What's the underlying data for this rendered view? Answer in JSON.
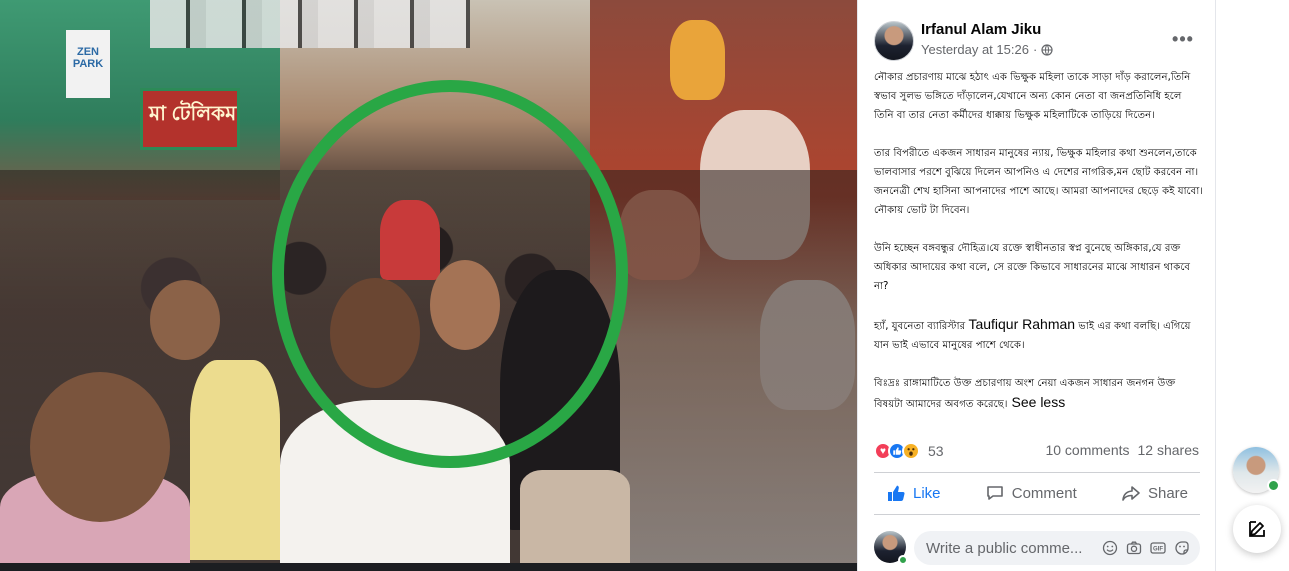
{
  "post": {
    "author": "Irfanul Alam Jiku",
    "timestamp": "Yesterday at 15:26",
    "privacy_separator": "·",
    "privacy_icon": "globe-icon",
    "more_icon": "more-options-icon",
    "paragraphs": [
      "নৌকার প্রচারণায় মাঝে হঠাৎ এক ভিক্ষুক মহিলা তাকে সাড়া দাঁড় করালেন,তিনি স্বভাব সুলভ ভঙ্গিতে দাঁড়ালেন,যেখানে অন্য কোন নেতা বা জনপ্রতিনিধি হলে তিনি বা তার নেতা কর্মীদের ধাক্কায় ভিক্ষুক মহিলাটিকে তাড়িয়ে দিতেন।",
      "তার বিপরীতে একজন সাধারন মানুষের ন্যায়, ভিক্ষুক মহিলার কথা শুনলেন,তাকে ভালবাসার পরশে বুঝিয়ে দিলেন আপনিও এ দেশের নাগরিক,মন ছোট করবেন না।জননেত্রী শেখ হাসিনা আপনাদের পাশে আছে। আমরা আপনাদের ছেড়ে কই যাবো। নৌকায় ভোট টা দিবেন।",
      "উনি হচ্ছেন বঙ্গবন্ধুর দৌহিত্র।যে রক্তে স্বাধীনতার স্বপ্ন বুনেছে অঙ্গিকার,যে রক্ত অধিকার আদায়ের কথা বলে, সে রক্তে কিভাবে সাধারনের মাঝে সাধারন থাকবে না?"
    ],
    "paragraph4_pre": "হ্যাঁ, যুবনেতা ব্যারিস্টার ",
    "paragraph4_name": "Taufiqur Rahman",
    "paragraph4_post": " ভাই এর কথা বলছি। এগিয়ে যান ভাই এভাবে মানুষের পাশে থেকে।",
    "paragraph5": "বিঃদ্রঃ রাঙ্গামাটিতে উক্ত প্রচারণায় অংশ নেয়া একজন সাধারন জনগন উক্ত বিষয়টা আমাদের অবগত করেছে।",
    "see_less": "See less"
  },
  "photo": {
    "sign_text": "মা টেলিকম",
    "sign_text2": "ZEN PARK",
    "highlight_color": "#29a745"
  },
  "stats": {
    "reaction_icons": [
      "love-icon",
      "like-icon",
      "wow-icon"
    ],
    "reaction_count": "53",
    "comments": "10 comments",
    "shares": "12 shares"
  },
  "actions": {
    "like": "Like",
    "comment": "Comment",
    "share": "Share"
  },
  "comment_box": {
    "placeholder": "Write a public comme...",
    "tools": [
      "emoji-icon",
      "camera-icon",
      "gif-icon",
      "sticker-icon"
    ]
  },
  "colors": {
    "like_blue": "#1877f2",
    "online_green": "#31a24c",
    "love_red": "#f33e58",
    "wow_yellow": "#f7b125"
  }
}
